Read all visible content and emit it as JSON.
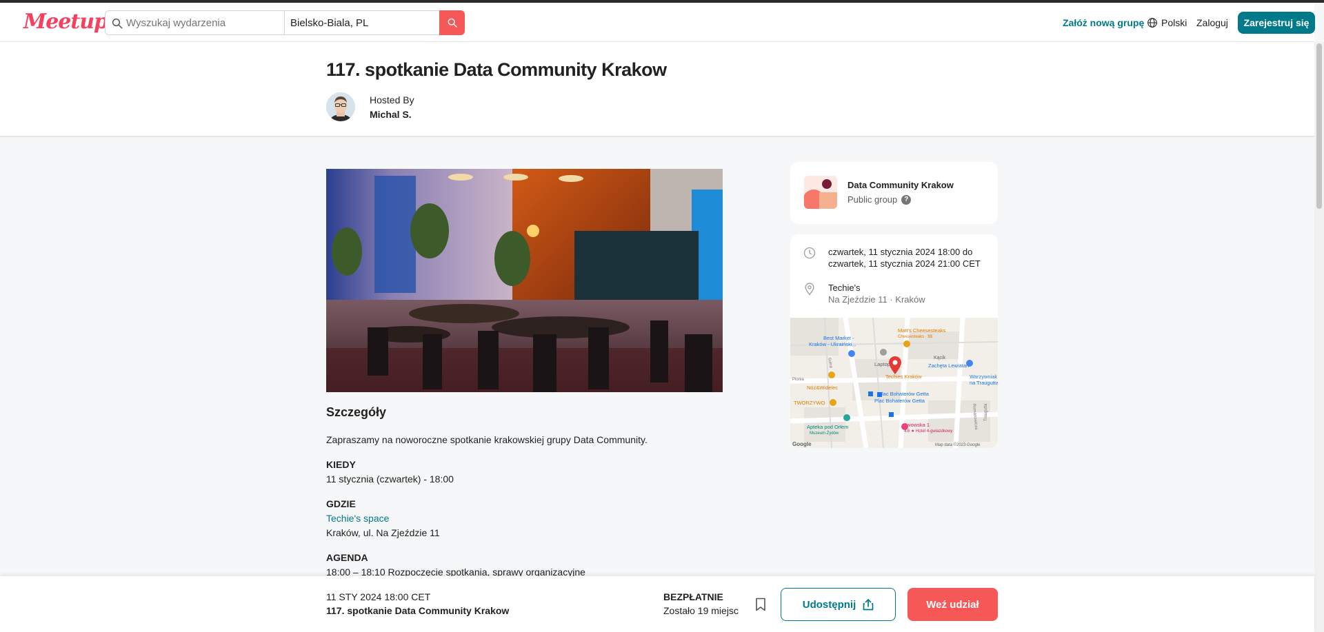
{
  "header": {
    "logo": "Meetup",
    "search_placeholder": "Wyszukaj wydarzenia",
    "location_value": "Bielsko-Biala, PL",
    "new_group": "Załóż nową grupę",
    "language": "Polski",
    "login": "Zaloguj",
    "register": "Zarejestruj się"
  },
  "event": {
    "title": "117. spotkanie Data Community Krakow",
    "hosted_by_label": "Hosted By",
    "host_name": "Michal S."
  },
  "details": {
    "title": "Szczegóły",
    "intro": "Zapraszamy na noworoczne spotkanie krakowskiej grupy Data Community.",
    "when_label": "KIEDY",
    "when_value": "11 stycznia (czwartek) - 18:00",
    "where_label": "GDZIE",
    "where_link": "Techie's space",
    "where_address": "Kraków, ul. Na Zjeździe 11",
    "agenda_label": "AGENDA",
    "agenda_first": "18:00 – 18:10 Rozpoczęcie spotkania, sprawy organizacyjne"
  },
  "group_card": {
    "name": "Data Community Krakow",
    "type": "Public group",
    "help": "?"
  },
  "info_card": {
    "datetime_line1": "czwartek, 11 stycznia 2024 18:00 do",
    "datetime_line2": "czwartek, 11 stycznia 2024 21:00 CET",
    "venue_name": "Techie's",
    "venue_address": "Na Zjeździe 11 · Kraków"
  },
  "map": {
    "labels": {
      "cheesesteaks": "Matt's Cheesesteaks",
      "cheesesteaks_sub": "Cheesesteaks · $$",
      "best_market": "Best Market -",
      "best_market2": "Kraków - Ukraiński...",
      "laptop": "Laptop",
      "techies": "Techies Kraków",
      "katcik": "Kącik",
      "zacheta": "Zachęta Lewiatan",
      "warzywniak": "Warzywniak",
      "warzywniak2": "na Traugutta",
      "noz": "Nóż&Widelec",
      "plac1": "Plac Bohaterów Getta",
      "plac2": "Plac Bohaterów Getta",
      "tworzywo": "TWORZYWO",
      "apteka": "Apteka pod Orłem",
      "muzeum": "Muzeum Żydów",
      "lwowska": "Lwowska 1",
      "hotel": "4.6 ★ Hotel 4-gwiazdkowy",
      "solna": "Solna",
      "plonia": "Plonia",
      "romanowicza": "Romanowicza",
      "traugutta": "Traugutta",
      "google": "Google",
      "copyright": "Map data ©2023 Google"
    }
  },
  "bottom_bar": {
    "date": "11 STY 2024 18:00 CET",
    "title": "117. spotkanie Data Community Krakow",
    "price": "BEZPŁATNIE",
    "spots": "Zostało 19 miejsc",
    "share": "Udostępnij",
    "attend": "Weź udział"
  },
  "colors": {
    "brand": "#f64060",
    "accent": "#00798a",
    "cta": "#f65858"
  }
}
